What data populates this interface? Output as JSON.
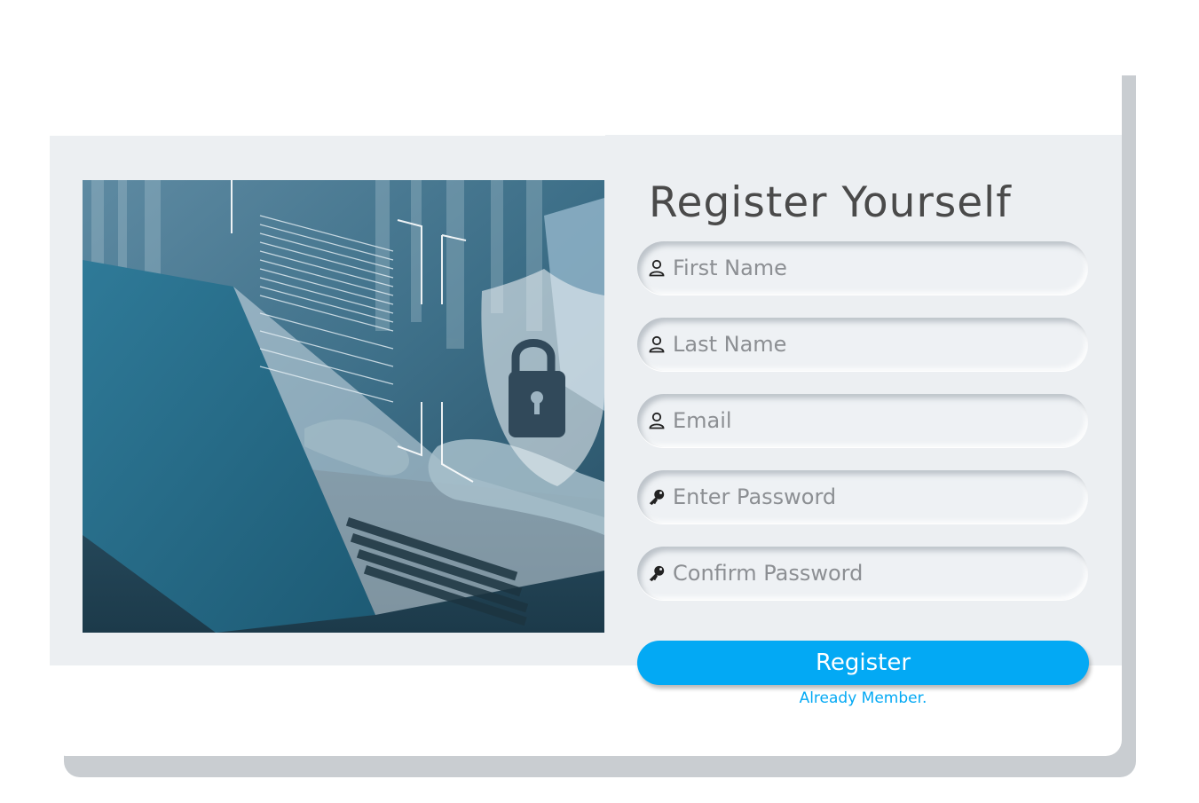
{
  "form": {
    "title": "Register Yourself",
    "fields": [
      {
        "placeholder": "First Name",
        "icon": "user-icon"
      },
      {
        "placeholder": "Last Name",
        "icon": "user-icon"
      },
      {
        "placeholder": "Email",
        "icon": "user-icon"
      },
      {
        "placeholder": "Enter Password",
        "icon": "key-icon"
      },
      {
        "placeholder": "Confirm Password",
        "icon": "key-icon"
      }
    ],
    "submit_label": "Register",
    "login_link": "Already Member."
  },
  "illustration": {
    "subject": "laptop-security-photo",
    "icons": [
      "shield-icon",
      "padlock-icon"
    ]
  },
  "colors": {
    "accent": "#03a9f4",
    "panel": "#eceff2",
    "shadow": "#c9cdd1",
    "title": "#4a4a4a",
    "placeholder": "#8c8f93"
  }
}
